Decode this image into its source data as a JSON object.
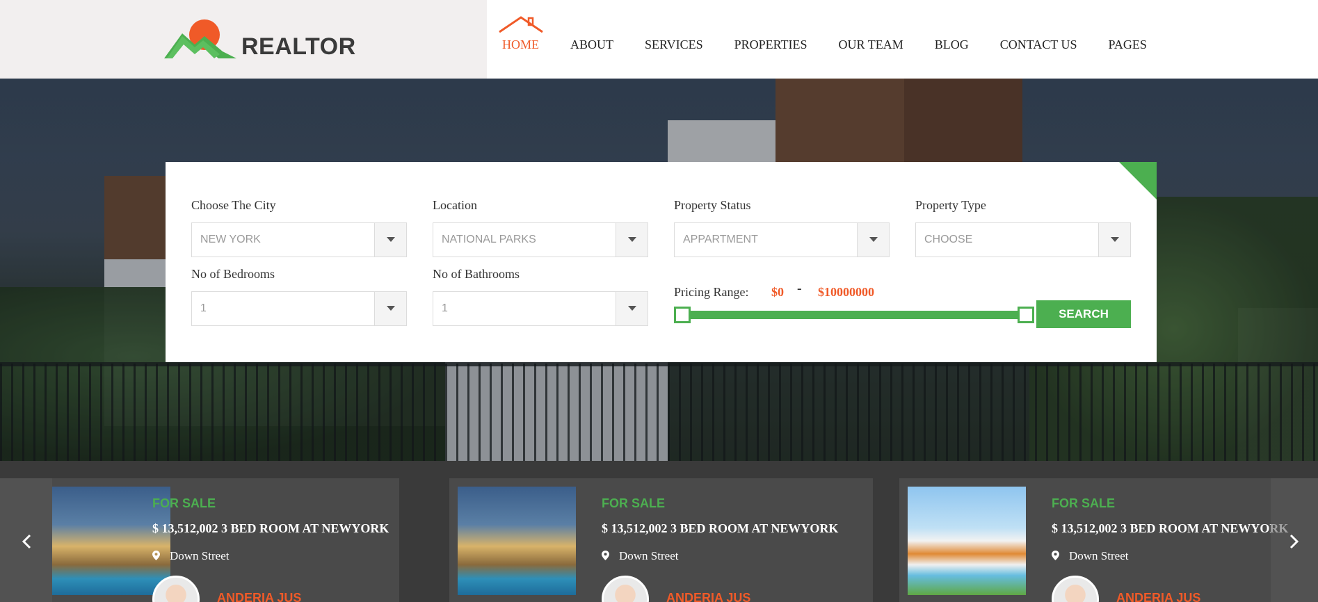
{
  "brand": {
    "name": "REALTOR"
  },
  "nav": {
    "items": [
      {
        "label": "HOME",
        "active": true
      },
      {
        "label": "ABOUT"
      },
      {
        "label": "SERVICES"
      },
      {
        "label": "PROPERTIES"
      },
      {
        "label": "OUR TEAM"
      },
      {
        "label": "BLOG"
      },
      {
        "label": "CONTACT US"
      },
      {
        "label": "PAGES"
      }
    ]
  },
  "search": {
    "city": {
      "label": "Choose The City",
      "value": "NEW YORK"
    },
    "location": {
      "label": "Location",
      "value": "NATIONAL PARKS"
    },
    "status": {
      "label": "Property Status",
      "value": "APPARTMENT"
    },
    "type": {
      "label": "Property Type",
      "value": "CHOOSE"
    },
    "bedrooms": {
      "label": "No of Bedrooms",
      "value": "1"
    },
    "bathrooms": {
      "label": "No of Bathrooms",
      "value": "1"
    },
    "price": {
      "label": "Pricing Range:",
      "min": "$0",
      "separator": "-",
      "max": "$10000000"
    },
    "button": "SEARCH"
  },
  "listings": [
    {
      "status": "FOR SALE",
      "title": "$ 13,512,002 3 BED ROOM AT NEWYORK",
      "location": "Down Street",
      "agent": "ANDERIA JUS"
    },
    {
      "status": "FOR SALE",
      "title": "$ 13,512,002 3 BED ROOM AT NEWYORK",
      "location": "Down Street",
      "agent": "ANDERIA JUS"
    },
    {
      "status": "FOR SALE",
      "title": "$ 13,512,002 3 BED ROOM AT NEWYORK",
      "location": "Down Street",
      "agent": "ANDERIA JUS"
    }
  ],
  "colors": {
    "accent": "#f05a28",
    "green": "#4caf50",
    "strip": "#3a3a3a",
    "card": "#4a4a4a"
  },
  "icons": {
    "prev": "chevron-left-icon",
    "next": "chevron-right-icon",
    "location": "map-pin-icon",
    "home": "house-roof-icon"
  }
}
